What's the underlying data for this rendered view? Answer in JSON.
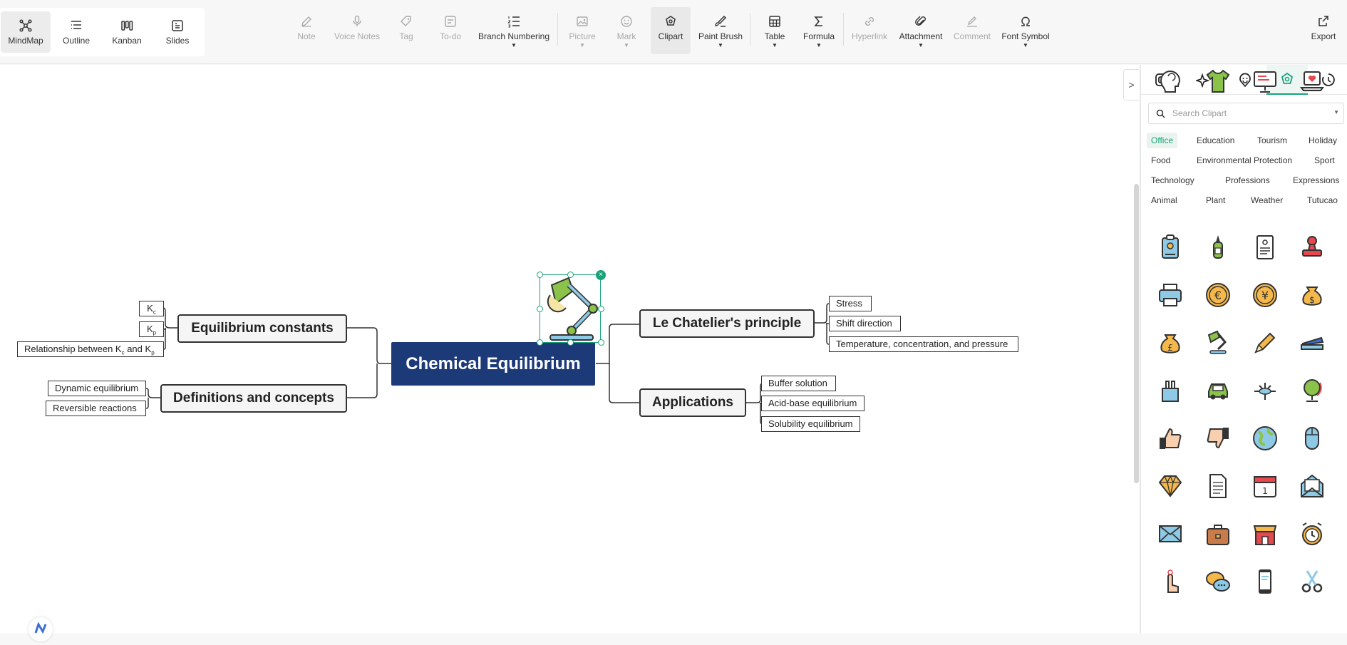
{
  "views": [
    {
      "label": "MindMap",
      "icon": "mindmap-icon",
      "active": true
    },
    {
      "label": "Outline",
      "icon": "outline-icon"
    },
    {
      "label": "Kanban",
      "icon": "kanban-icon"
    },
    {
      "label": "Slides",
      "icon": "slides-icon"
    }
  ],
  "toolbar": {
    "note": "Note",
    "voice_notes": "Voice Notes",
    "tag": "Tag",
    "todo": "To-do",
    "branch_numbering": "Branch Numbering",
    "picture": "Picture",
    "mark": "Mark",
    "clipart": "Clipart",
    "paint_brush": "Paint Brush",
    "table": "Table",
    "formula": "Formula",
    "hyperlink": "Hyperlink",
    "attachment": "Attachment",
    "comment": "Comment",
    "font_symbol": "Font Symbol",
    "export": "Export"
  },
  "mindmap": {
    "central": "Chemical Equilibrium",
    "left": [
      {
        "title": "Equilibrium constants",
        "children": [
          "Kc",
          "Kp",
          "Relationship between Kc and Kp"
        ]
      },
      {
        "title": "Definitions and concepts",
        "children": [
          "Dynamic equilibrium",
          "Reversible reactions"
        ]
      }
    ],
    "right": [
      {
        "title": "Le Chatelier's principle",
        "children": [
          "Stress",
          "Shift direction",
          "Temperature, concentration, and pressure"
        ]
      },
      {
        "title": "Applications",
        "children": [
          "Buffer solution",
          "Acid-base equilibrium",
          "Solubility equilibrium"
        ]
      }
    ],
    "subscripts": {
      "kc_main": "K",
      "kc_sub": "c",
      "kp_main": "K",
      "kp_sub": "p",
      "rel_prefix": "Relationship between K",
      "rel_c": "c",
      "rel_mid": " and K",
      "rel_p": "p"
    }
  },
  "panel": {
    "tabs": [
      "style-icon",
      "ai-icon",
      "mark-icon",
      "clipart-icon",
      "history-icon"
    ],
    "active_tab": "clipart-icon",
    "search_placeholder": "Search Clipart",
    "categories": [
      [
        "Office",
        "Education",
        "Tourism",
        "Holiday"
      ],
      [
        "Food",
        "Environmental Protection",
        "Sport"
      ],
      [
        "Technology",
        "Professions",
        "Expressions"
      ],
      [
        "Animal",
        "Plant",
        "Weather",
        "Tutucao"
      ]
    ],
    "active_category": "Office",
    "clipart": [
      "id-badge-icon",
      "glue-bottle-icon",
      "document-icon",
      "stamp-icon",
      "printer-icon",
      "euro-coin-icon",
      "yen-coin-icon",
      "dollar-bag-icon",
      "pound-bag-icon",
      "desk-lamp-icon",
      "pencil-icon",
      "stapler-icon",
      "binder-clip-icon",
      "car-icon",
      "airplane-icon",
      "globe-stand-icon",
      "thumbs-up-icon",
      "thumbs-down-icon",
      "earth-icon",
      "mouse-icon",
      "diamond-icon",
      "paper-icon",
      "calendar-icon",
      "mail-open-icon",
      "envelope-icon",
      "briefcase-icon",
      "shop-icon",
      "alarm-clock-icon",
      "touch-hand-icon",
      "chat-bubbles-icon",
      "smartphone-icon",
      "scissors-icon",
      "head-icon",
      "shirt-icon",
      "monitor-icon",
      "laptop-heart-icon"
    ],
    "calendar_day": "1"
  },
  "colors": {
    "central": "#1c3a78",
    "accent": "#1aa37a",
    "clip_green": "#8bc34a",
    "clip_orange": "#f5b84a",
    "clip_blue": "#8ecae6",
    "clip_red": "#e5484d"
  }
}
